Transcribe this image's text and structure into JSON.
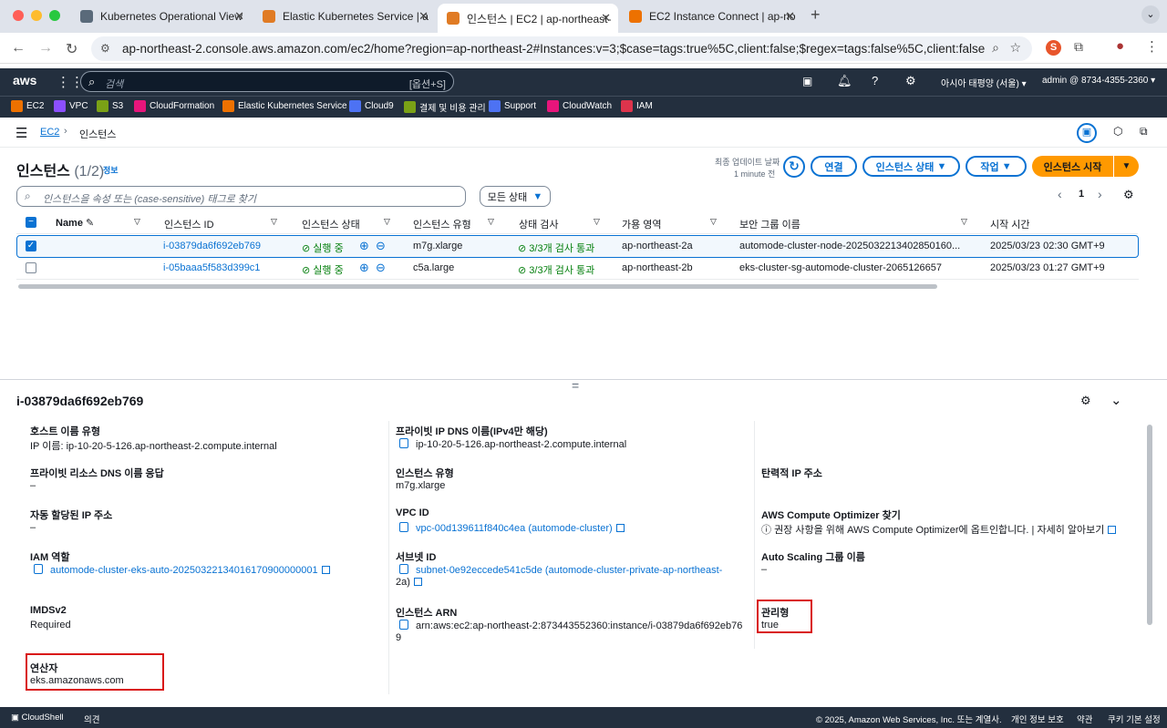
{
  "browser": {
    "tabs": [
      {
        "label": "Kubernetes Operational View",
        "color": "#5a6a7a"
      },
      {
        "label": "Elastic Kubernetes Service | a",
        "color": "#e07b24"
      },
      {
        "label": "인스턴스 | EC2 | ap-northeast-",
        "color": "#e07b24"
      },
      {
        "label": "EC2 Instance Connect | ap-no",
        "color": "#ed7100"
      }
    ],
    "new_tab": "+",
    "url": "ap-northeast-2.console.aws.amazon.com/ec2/home?region=ap-northeast-2#Instances:v=3;$case=tags:true%5C,client:false;$regex=tags:false%5C,client:false"
  },
  "aws_header": {
    "logo": "aws",
    "search_placeholder": "검색",
    "search_shortcut": "[옵션+S]",
    "region": "아시아 태평양 (서울)",
    "account": "admin @ 8734-4355-2360"
  },
  "favorites": [
    {
      "label": "EC2",
      "color": "#ed7100"
    },
    {
      "label": "VPC",
      "color": "#8c4fff"
    },
    {
      "label": "S3",
      "color": "#7aa116"
    },
    {
      "label": "CloudFormation",
      "color": "#e7157b"
    },
    {
      "label": "Elastic Kubernetes Service",
      "color": "#ed7100"
    },
    {
      "label": "Cloud9",
      "color": "#4d72f3"
    },
    {
      "label": "결제 및 비용 관리",
      "color": "#7aa116"
    },
    {
      "label": "Support",
      "color": "#4d72f3"
    },
    {
      "label": "CloudWatch",
      "color": "#e7157b"
    },
    {
      "label": "IAM",
      "color": "#dd344c"
    }
  ],
  "breadcrumb": {
    "root": "EC2",
    "current": "인스턴스"
  },
  "instances": {
    "title": "인스턴스",
    "count": "(1/2)",
    "info": "정보",
    "last_updated_label": "최종 업데이트 날짜",
    "last_updated_value": "1 minute 전",
    "connect": "연결",
    "state_btn": "인스턴스 상태",
    "actions": "작업",
    "launch": "인스턴스 시작",
    "filter_placeholder": "인스턴스을 속성 또는 (case-sensitive) 태그로 찾기",
    "state_filter": "모든 상태",
    "page": "1",
    "columns": [
      "Name",
      "인스턴스 ID",
      "인스턴스 상태",
      "인스턴스 유형",
      "상태 검사",
      "가용 영역",
      "보안 그룹 이름",
      "시작 시간"
    ],
    "rows": [
      {
        "id": "i-03879da6f692eb769",
        "state": "실행 중",
        "type": "m7g.xlarge",
        "check": "3/3개 검사 통과",
        "az": "ap-northeast-2a",
        "sg": "automode-cluster-node-2025032213402850160...",
        "launch": "2025/03/23 02:30 GMT+9"
      },
      {
        "id": "i-05baaa5f583d399c1",
        "state": "실행 중",
        "type": "c5a.large",
        "check": "3/3개 검사 통과",
        "az": "ap-northeast-2b",
        "sg": "eks-cluster-sg-automode-cluster-2065126657",
        "launch": "2025/03/23 01:27 GMT+9"
      }
    ]
  },
  "details": {
    "title": "i-03879da6f692eb769",
    "host_type_label": "호스트 이름 유형",
    "host_type_value": "IP 이름: ip-10-20-5-126.ap-northeast-2.compute.internal",
    "private_dns_label": "프라이빗 IP DNS 이름(IPv4만 해당)",
    "private_dns_value": "ip-10-20-5-126.ap-northeast-2.compute.internal",
    "resource_dns_label": "프라이빗 리소스 DNS 이름 응답",
    "resource_dns_value": "–",
    "instance_type_label": "인스턴스 유형",
    "instance_type_value": "m7g.xlarge",
    "elastic_ip_label": "탄력적 IP 주소",
    "auto_ip_label": "자동 할당된 IP 주소",
    "auto_ip_value": "–",
    "vpc_label": "VPC ID",
    "vpc_value": "vpc-00d139611f840c4ea (automode-cluster)",
    "optimizer_label": "AWS Compute Optimizer 찾기",
    "optimizer_value": "권장 사항을 위해 AWS Compute Optimizer에 옵트인합니다.",
    "optimizer_sep": "|",
    "optimizer_more": "자세히 알아보기",
    "iam_label": "IAM 역할",
    "iam_value": "automode-cluster-eks-auto-20250322134016170900000001",
    "subnet_label": "서브넷 ID",
    "subnet_value1": "subnet-0e92eccede541c5de (automode-cluster-private-ap-northeast-",
    "subnet_value2": "2a)",
    "asg_label": "Auto Scaling 그룹 이름",
    "asg_value": "–",
    "imds_label": "IMDSv2",
    "imds_value": "Required",
    "arn_label": "인스턴스 ARN",
    "arn_value1": "arn:aws:ec2:ap-northeast-2:873443552360:instance/i-03879da6f692eb76",
    "arn_value2": "9",
    "managed_label": "관리형",
    "managed_value": "true",
    "operator_label": "연산자",
    "operator_value": "eks.amazonaws.com"
  },
  "footer": {
    "cloudshell": "CloudShell",
    "feedback": "의견",
    "copyright": "© 2025, Amazon Web Services, Inc. 또는 계열사.",
    "privacy": "개인 정보 보호",
    "terms": "약관",
    "cookies": "쿠키 기본 설정"
  }
}
